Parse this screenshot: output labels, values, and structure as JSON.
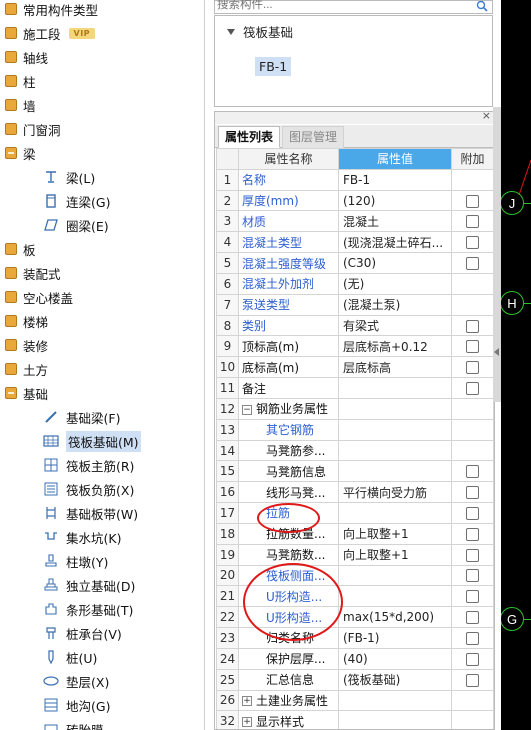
{
  "left_tree": {
    "items": [
      {
        "label": "常用构件类型",
        "kind": "cat",
        "expanded": false
      },
      {
        "label": "施工段",
        "kind": "cat",
        "expanded": false,
        "badge": "VIP"
      },
      {
        "label": "轴线",
        "kind": "cat",
        "expanded": false
      },
      {
        "label": "柱",
        "kind": "cat",
        "expanded": false
      },
      {
        "label": "墙",
        "kind": "cat",
        "expanded": false
      },
      {
        "label": "门窗洞",
        "kind": "cat",
        "expanded": false
      },
      {
        "label": "梁",
        "kind": "cat",
        "expanded": true
      },
      {
        "label": "梁(L)",
        "kind": "sub",
        "icon": "beam-icon"
      },
      {
        "label": "连梁(G)",
        "kind": "sub",
        "icon": "coupling-beam-icon"
      },
      {
        "label": "圈梁(E)",
        "kind": "sub",
        "icon": "ring-beam-icon"
      },
      {
        "label": "板",
        "kind": "cat",
        "expanded": false
      },
      {
        "label": "装配式",
        "kind": "cat",
        "expanded": false
      },
      {
        "label": "空心楼盖",
        "kind": "cat",
        "expanded": false
      },
      {
        "label": "楼梯",
        "kind": "cat",
        "expanded": false
      },
      {
        "label": "装修",
        "kind": "cat",
        "expanded": false
      },
      {
        "label": "土方",
        "kind": "cat",
        "expanded": false
      },
      {
        "label": "基础",
        "kind": "cat",
        "expanded": true
      },
      {
        "label": "基础梁(F)",
        "kind": "sub",
        "icon": "foundation-beam-icon"
      },
      {
        "label": "筏板基础(M)",
        "kind": "sub",
        "icon": "raft-foundation-icon",
        "selected": true
      },
      {
        "label": "筏板主筋(R)",
        "kind": "sub",
        "icon": "raft-main-rebar-icon"
      },
      {
        "label": "筏板负筋(X)",
        "kind": "sub",
        "icon": "raft-negative-rebar-icon"
      },
      {
        "label": "基础板带(W)",
        "kind": "sub",
        "icon": "foundation-strip-icon"
      },
      {
        "label": "集水坑(K)",
        "kind": "sub",
        "icon": "sump-pit-icon"
      },
      {
        "label": "柱墩(Y)",
        "kind": "sub",
        "icon": "column-pier-icon"
      },
      {
        "label": "独立基础(D)",
        "kind": "sub",
        "icon": "isolated-footing-icon"
      },
      {
        "label": "条形基础(T)",
        "kind": "sub",
        "icon": "strip-footing-icon"
      },
      {
        "label": "桩承台(V)",
        "kind": "sub",
        "icon": "pile-cap-icon"
      },
      {
        "label": "桩(U)",
        "kind": "sub",
        "icon": "pile-icon"
      },
      {
        "label": "垫层(X)",
        "kind": "sub",
        "icon": "cushion-icon"
      },
      {
        "label": "地沟(G)",
        "kind": "sub",
        "icon": "trench-icon"
      },
      {
        "label": "砖胎膜",
        "kind": "sub",
        "icon": "brick-mold-icon"
      }
    ]
  },
  "search": {
    "placeholder": "搜索构件..."
  },
  "component_tree": {
    "root": "筏板基础",
    "child": "FB-1"
  },
  "property_panel": {
    "tabs": [
      {
        "label": "属性列表",
        "active": true
      },
      {
        "label": "图层管理",
        "active": false
      }
    ],
    "headers": {
      "name": "属性名称",
      "value": "属性值",
      "attach": "附加"
    },
    "rows": [
      {
        "num": "1",
        "name": "名称",
        "value": "FB-1",
        "color": "blue",
        "checkbox": false,
        "indent": false
      },
      {
        "num": "2",
        "name": "厚度(mm)",
        "value": "(120)",
        "color": "blue",
        "checkbox": true,
        "indent": false
      },
      {
        "num": "3",
        "name": "材质",
        "value": "混凝土",
        "color": "blue",
        "checkbox": true,
        "indent": false
      },
      {
        "num": "4",
        "name": "混凝土类型",
        "value": "(现浇混凝土碎石...",
        "color": "blue",
        "checkbox": true,
        "indent": false
      },
      {
        "num": "5",
        "name": "混凝土强度等级",
        "value": "(C30)",
        "color": "blue",
        "checkbox": true,
        "indent": false
      },
      {
        "num": "6",
        "name": "混凝土外加剂",
        "value": "(无)",
        "color": "blue",
        "checkbox": false,
        "indent": false
      },
      {
        "num": "7",
        "name": "泵送类型",
        "value": "(混凝土泵)",
        "color": "blue",
        "checkbox": false,
        "indent": false
      },
      {
        "num": "8",
        "name": "类别",
        "value": "有梁式",
        "color": "blue",
        "checkbox": true,
        "indent": false
      },
      {
        "num": "9",
        "name": "顶标高(m)",
        "value": "层底标高+0.12",
        "color": "black",
        "checkbox": true,
        "indent": false
      },
      {
        "num": "10",
        "name": "底标高(m)",
        "value": "层底标高",
        "color": "black",
        "checkbox": true,
        "indent": false
      },
      {
        "num": "11",
        "name": "备注",
        "value": "",
        "color": "black",
        "checkbox": true,
        "indent": false
      },
      {
        "num": "12",
        "name": "钢筋业务属性",
        "value": "",
        "color": "black",
        "checkbox": false,
        "indent": false,
        "group": "−"
      },
      {
        "num": "13",
        "name": "其它钢筋",
        "value": "",
        "color": "blue",
        "checkbox": false,
        "indent": true
      },
      {
        "num": "14",
        "name": "马凳筋参...",
        "value": "",
        "color": "black",
        "checkbox": false,
        "indent": true
      },
      {
        "num": "15",
        "name": "马凳筋信息",
        "value": "",
        "color": "black",
        "checkbox": true,
        "indent": true
      },
      {
        "num": "16",
        "name": "线形马凳...",
        "value": "平行横向受力筋",
        "color": "black",
        "checkbox": true,
        "indent": true
      },
      {
        "num": "17",
        "name": "拉筋",
        "value": "",
        "color": "blue",
        "checkbox": true,
        "indent": true
      },
      {
        "num": "18",
        "name": "拉筋数量...",
        "value": "向上取整+1",
        "color": "black",
        "checkbox": true,
        "indent": true
      },
      {
        "num": "19",
        "name": "马凳筋数...",
        "value": "向上取整+1",
        "color": "black",
        "checkbox": true,
        "indent": true
      },
      {
        "num": "20",
        "name": "筏板侧面...",
        "value": "",
        "color": "blue",
        "checkbox": true,
        "indent": true
      },
      {
        "num": "21",
        "name": "U形构造...",
        "value": "",
        "color": "blue",
        "checkbox": true,
        "indent": true
      },
      {
        "num": "22",
        "name": "U形构造...",
        "value": "max(15*d,200)",
        "color": "blue",
        "checkbox": true,
        "indent": true
      },
      {
        "num": "23",
        "name": "归类名称",
        "value": "(FB-1)",
        "color": "black",
        "checkbox": true,
        "indent": true
      },
      {
        "num": "24",
        "name": "保护层厚...",
        "value": "(40)",
        "color": "black",
        "checkbox": true,
        "indent": true
      },
      {
        "num": "25",
        "name": "汇总信息",
        "value": "(筏板基础)",
        "color": "black",
        "checkbox": true,
        "indent": true
      },
      {
        "num": "26",
        "name": "土建业务属性",
        "value": "",
        "color": "black",
        "checkbox": false,
        "indent": false,
        "group": "+"
      },
      {
        "num": "32",
        "name": "显示样式",
        "value": "",
        "color": "black",
        "checkbox": false,
        "indent": false,
        "group": "+"
      }
    ]
  },
  "canvas": {
    "axes": [
      {
        "label": "J"
      },
      {
        "label": "H"
      },
      {
        "label": "G"
      }
    ],
    "grid_color": "#2fbf2f",
    "background": "#000000"
  },
  "colors": {
    "accent": "#4aa7e8",
    "link_blue": "#2d5fd1",
    "selection": "#cfe0f5",
    "annotation_red": "#e01818"
  }
}
